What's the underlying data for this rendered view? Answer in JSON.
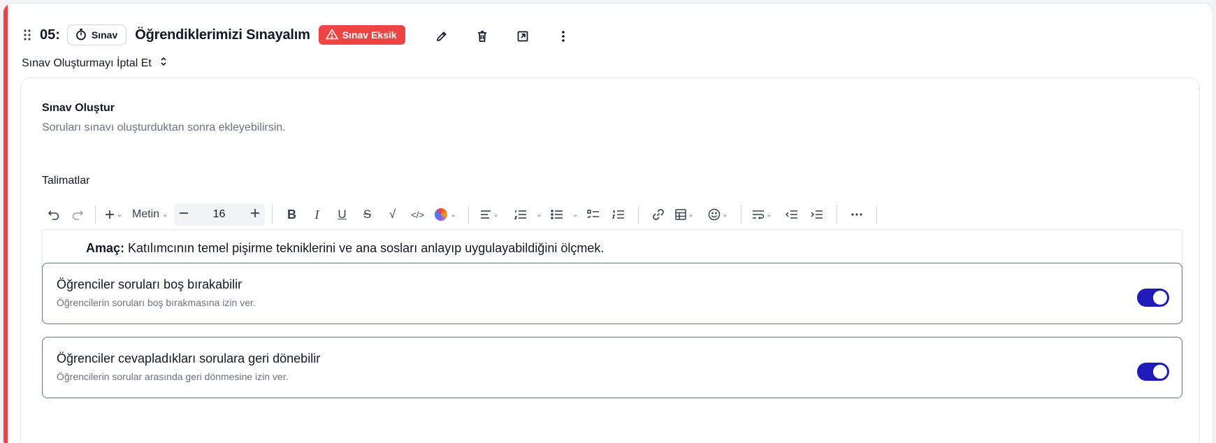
{
  "header": {
    "number": "05:",
    "type_label": "Sınav",
    "type_icon": "stopwatch-icon",
    "title": "Öğrendiklerimizi Sınayalım",
    "warning_badge": "Sınav Eksik",
    "warning_color": "#ef4444",
    "actions": [
      "edit-icon",
      "trash-icon",
      "open-external-icon",
      "more-vertical-icon"
    ]
  },
  "cancel": {
    "label": "Sınav Oluşturmayı İptal Et",
    "icon": "chevron-up-down-icon"
  },
  "panel": {
    "title": "Sınav Oluştur",
    "description": "Soruları sınavı oluşturduktan sonra ekleyebilirsin.",
    "instructions_label": "Talimatlar"
  },
  "toolbar": {
    "text_style": "Metin",
    "font_size": "16"
  },
  "editor": {
    "bold_prefix": "Amaç:",
    "text": " Katılımcının temel pişirme tekniklerini ve ana sosları anlayıp uygulayabildiğini ölçmek."
  },
  "settings": [
    {
      "title": "Öğrenciler soruları boş bırakabilir",
      "description": "Öğrencilerin soruları boş bırakmasına izin ver.",
      "enabled": true
    },
    {
      "title": "Öğrenciler cevapladıkları sorulara geri dönebilir",
      "description": "Öğrencilerin sorular arasında geri dönmesine izin ver.",
      "enabled": true
    }
  ],
  "colors": {
    "accent": "#ef4444",
    "toggle_on": "#1e1bb8"
  }
}
